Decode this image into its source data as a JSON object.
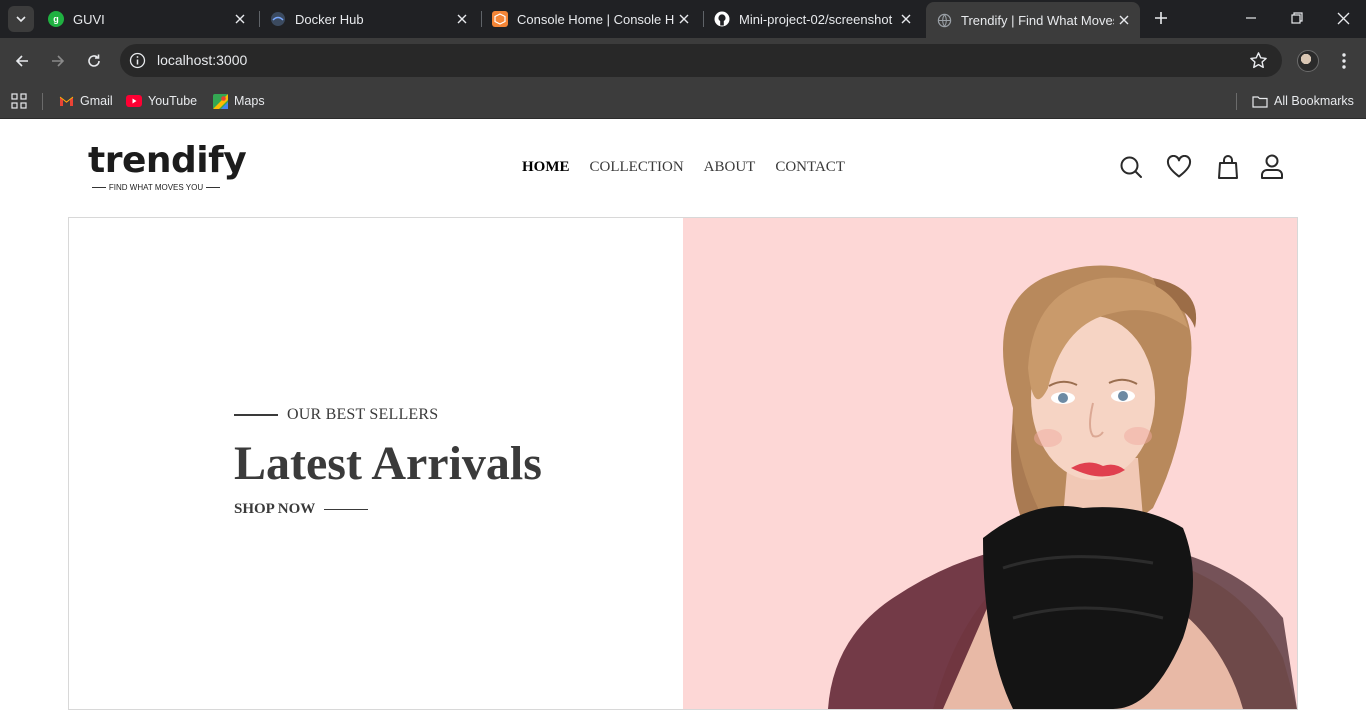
{
  "browser": {
    "tabs": [
      {
        "title": "GUVI",
        "favicon": "guvi-icon",
        "color": "#1fb141"
      },
      {
        "title": "Docker Hub",
        "favicon": "docker-icon",
        "color": "#1d63ed"
      },
      {
        "title": "Console Home | Console Ho",
        "favicon": "aws-icon",
        "color": "#f58536"
      },
      {
        "title": "Mini-project-02/screenshot",
        "favicon": "github-icon",
        "color": "#ffffff"
      },
      {
        "title": "Trendify | Find What Moves Y",
        "favicon": "globe-icon",
        "color": "#9aa0a6",
        "active": true
      }
    ],
    "address": "localhost:3000",
    "bookmarks": [
      {
        "label": "Gmail",
        "icon": "gmail-icon"
      },
      {
        "label": "YouTube",
        "icon": "youtube-icon"
      },
      {
        "label": "Maps",
        "icon": "maps-icon"
      }
    ],
    "all_bookmarks": "All Bookmarks"
  },
  "site": {
    "logo": {
      "word": "trendify",
      "tagline": "FIND WHAT MOVES YOU"
    },
    "nav": [
      "HOME",
      "COLLECTION",
      "ABOUT",
      "CONTACT"
    ],
    "active_nav": "HOME",
    "icons": [
      "search-icon",
      "heart-icon",
      "bag-icon",
      "user-icon"
    ]
  },
  "hero": {
    "eyebrow": "OUR BEST SELLERS",
    "headline": "Latest Arrivals",
    "cta": "SHOP NOW",
    "background": "#fdd7d6"
  }
}
